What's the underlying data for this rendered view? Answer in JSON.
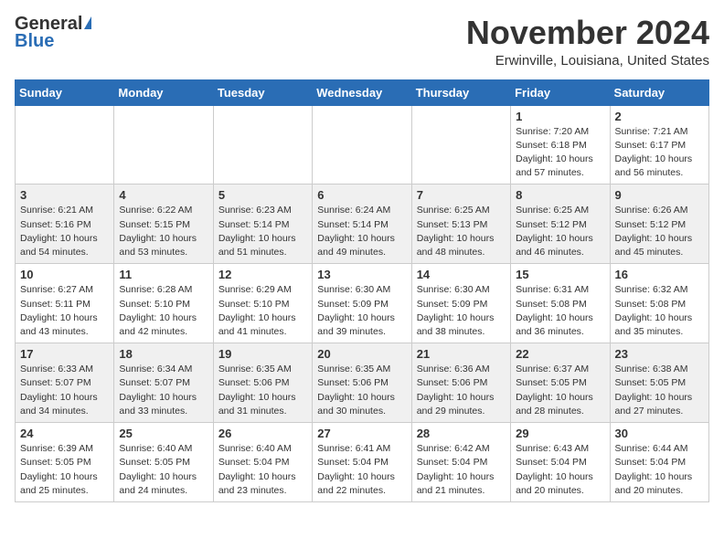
{
  "header": {
    "logo_general": "General",
    "logo_blue": "Blue",
    "month_title": "November 2024",
    "location": "Erwinville, Louisiana, United States"
  },
  "days_of_week": [
    "Sunday",
    "Monday",
    "Tuesday",
    "Wednesday",
    "Thursday",
    "Friday",
    "Saturday"
  ],
  "weeks": [
    [
      {
        "day": "",
        "info": ""
      },
      {
        "day": "",
        "info": ""
      },
      {
        "day": "",
        "info": ""
      },
      {
        "day": "",
        "info": ""
      },
      {
        "day": "",
        "info": ""
      },
      {
        "day": "1",
        "info": "Sunrise: 7:20 AM\nSunset: 6:18 PM\nDaylight: 10 hours\nand 57 minutes."
      },
      {
        "day": "2",
        "info": "Sunrise: 7:21 AM\nSunset: 6:17 PM\nDaylight: 10 hours\nand 56 minutes."
      }
    ],
    [
      {
        "day": "3",
        "info": "Sunrise: 6:21 AM\nSunset: 5:16 PM\nDaylight: 10 hours\nand 54 minutes."
      },
      {
        "day": "4",
        "info": "Sunrise: 6:22 AM\nSunset: 5:15 PM\nDaylight: 10 hours\nand 53 minutes."
      },
      {
        "day": "5",
        "info": "Sunrise: 6:23 AM\nSunset: 5:14 PM\nDaylight: 10 hours\nand 51 minutes."
      },
      {
        "day": "6",
        "info": "Sunrise: 6:24 AM\nSunset: 5:14 PM\nDaylight: 10 hours\nand 49 minutes."
      },
      {
        "day": "7",
        "info": "Sunrise: 6:25 AM\nSunset: 5:13 PM\nDaylight: 10 hours\nand 48 minutes."
      },
      {
        "day": "8",
        "info": "Sunrise: 6:25 AM\nSunset: 5:12 PM\nDaylight: 10 hours\nand 46 minutes."
      },
      {
        "day": "9",
        "info": "Sunrise: 6:26 AM\nSunset: 5:12 PM\nDaylight: 10 hours\nand 45 minutes."
      }
    ],
    [
      {
        "day": "10",
        "info": "Sunrise: 6:27 AM\nSunset: 5:11 PM\nDaylight: 10 hours\nand 43 minutes."
      },
      {
        "day": "11",
        "info": "Sunrise: 6:28 AM\nSunset: 5:10 PM\nDaylight: 10 hours\nand 42 minutes."
      },
      {
        "day": "12",
        "info": "Sunrise: 6:29 AM\nSunset: 5:10 PM\nDaylight: 10 hours\nand 41 minutes."
      },
      {
        "day": "13",
        "info": "Sunrise: 6:30 AM\nSunset: 5:09 PM\nDaylight: 10 hours\nand 39 minutes."
      },
      {
        "day": "14",
        "info": "Sunrise: 6:30 AM\nSunset: 5:09 PM\nDaylight: 10 hours\nand 38 minutes."
      },
      {
        "day": "15",
        "info": "Sunrise: 6:31 AM\nSunset: 5:08 PM\nDaylight: 10 hours\nand 36 minutes."
      },
      {
        "day": "16",
        "info": "Sunrise: 6:32 AM\nSunset: 5:08 PM\nDaylight: 10 hours\nand 35 minutes."
      }
    ],
    [
      {
        "day": "17",
        "info": "Sunrise: 6:33 AM\nSunset: 5:07 PM\nDaylight: 10 hours\nand 34 minutes."
      },
      {
        "day": "18",
        "info": "Sunrise: 6:34 AM\nSunset: 5:07 PM\nDaylight: 10 hours\nand 33 minutes."
      },
      {
        "day": "19",
        "info": "Sunrise: 6:35 AM\nSunset: 5:06 PM\nDaylight: 10 hours\nand 31 minutes."
      },
      {
        "day": "20",
        "info": "Sunrise: 6:35 AM\nSunset: 5:06 PM\nDaylight: 10 hours\nand 30 minutes."
      },
      {
        "day": "21",
        "info": "Sunrise: 6:36 AM\nSunset: 5:06 PM\nDaylight: 10 hours\nand 29 minutes."
      },
      {
        "day": "22",
        "info": "Sunrise: 6:37 AM\nSunset: 5:05 PM\nDaylight: 10 hours\nand 28 minutes."
      },
      {
        "day": "23",
        "info": "Sunrise: 6:38 AM\nSunset: 5:05 PM\nDaylight: 10 hours\nand 27 minutes."
      }
    ],
    [
      {
        "day": "24",
        "info": "Sunrise: 6:39 AM\nSunset: 5:05 PM\nDaylight: 10 hours\nand 25 minutes."
      },
      {
        "day": "25",
        "info": "Sunrise: 6:40 AM\nSunset: 5:05 PM\nDaylight: 10 hours\nand 24 minutes."
      },
      {
        "day": "26",
        "info": "Sunrise: 6:40 AM\nSunset: 5:04 PM\nDaylight: 10 hours\nand 23 minutes."
      },
      {
        "day": "27",
        "info": "Sunrise: 6:41 AM\nSunset: 5:04 PM\nDaylight: 10 hours\nand 22 minutes."
      },
      {
        "day": "28",
        "info": "Sunrise: 6:42 AM\nSunset: 5:04 PM\nDaylight: 10 hours\nand 21 minutes."
      },
      {
        "day": "29",
        "info": "Sunrise: 6:43 AM\nSunset: 5:04 PM\nDaylight: 10 hours\nand 20 minutes."
      },
      {
        "day": "30",
        "info": "Sunrise: 6:44 AM\nSunset: 5:04 PM\nDaylight: 10 hours\nand 20 minutes."
      }
    ]
  ]
}
